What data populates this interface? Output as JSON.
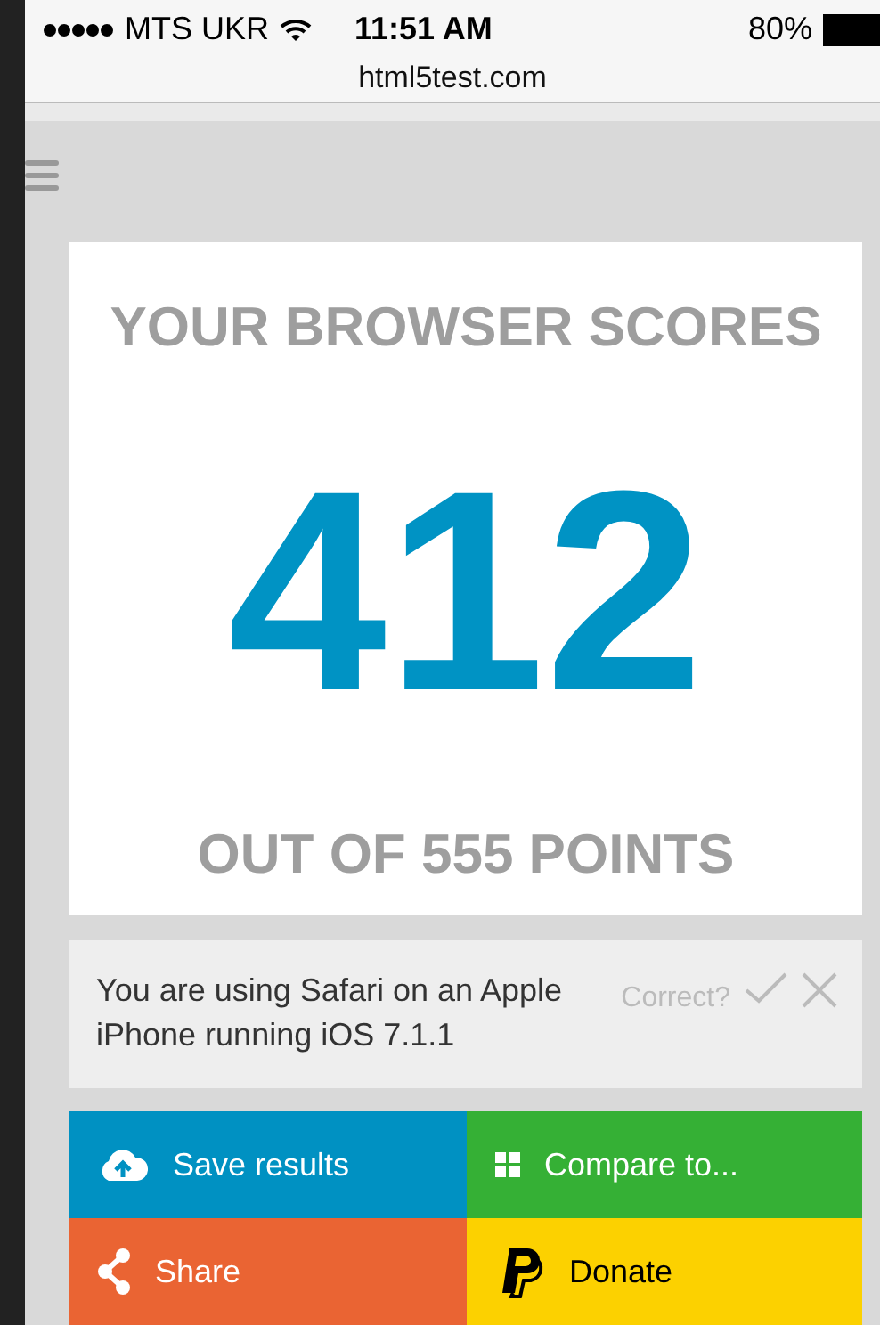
{
  "status_bar": {
    "carrier": "MTS UKR",
    "time": "11:51 AM",
    "battery": "80%"
  },
  "address_bar": {
    "url": "html5test.com"
  },
  "score_card": {
    "heading": "YOUR BROWSER SCORES",
    "score": "412",
    "total": "OUT OF 555 POINTS"
  },
  "detection": {
    "text": "You are using Safari on an Apple iPhone running iOS 7.1.1",
    "question": "Correct?"
  },
  "actions": [
    {
      "kind": "save",
      "label": "Save results",
      "color": "#0091c2"
    },
    {
      "kind": "compare",
      "label": "Compare to...",
      "color": "#35b035"
    },
    {
      "kind": "share",
      "label": "Share",
      "color": "#ea6433"
    },
    {
      "kind": "donate",
      "label": "Donate",
      "color": "#fcd100"
    }
  ]
}
